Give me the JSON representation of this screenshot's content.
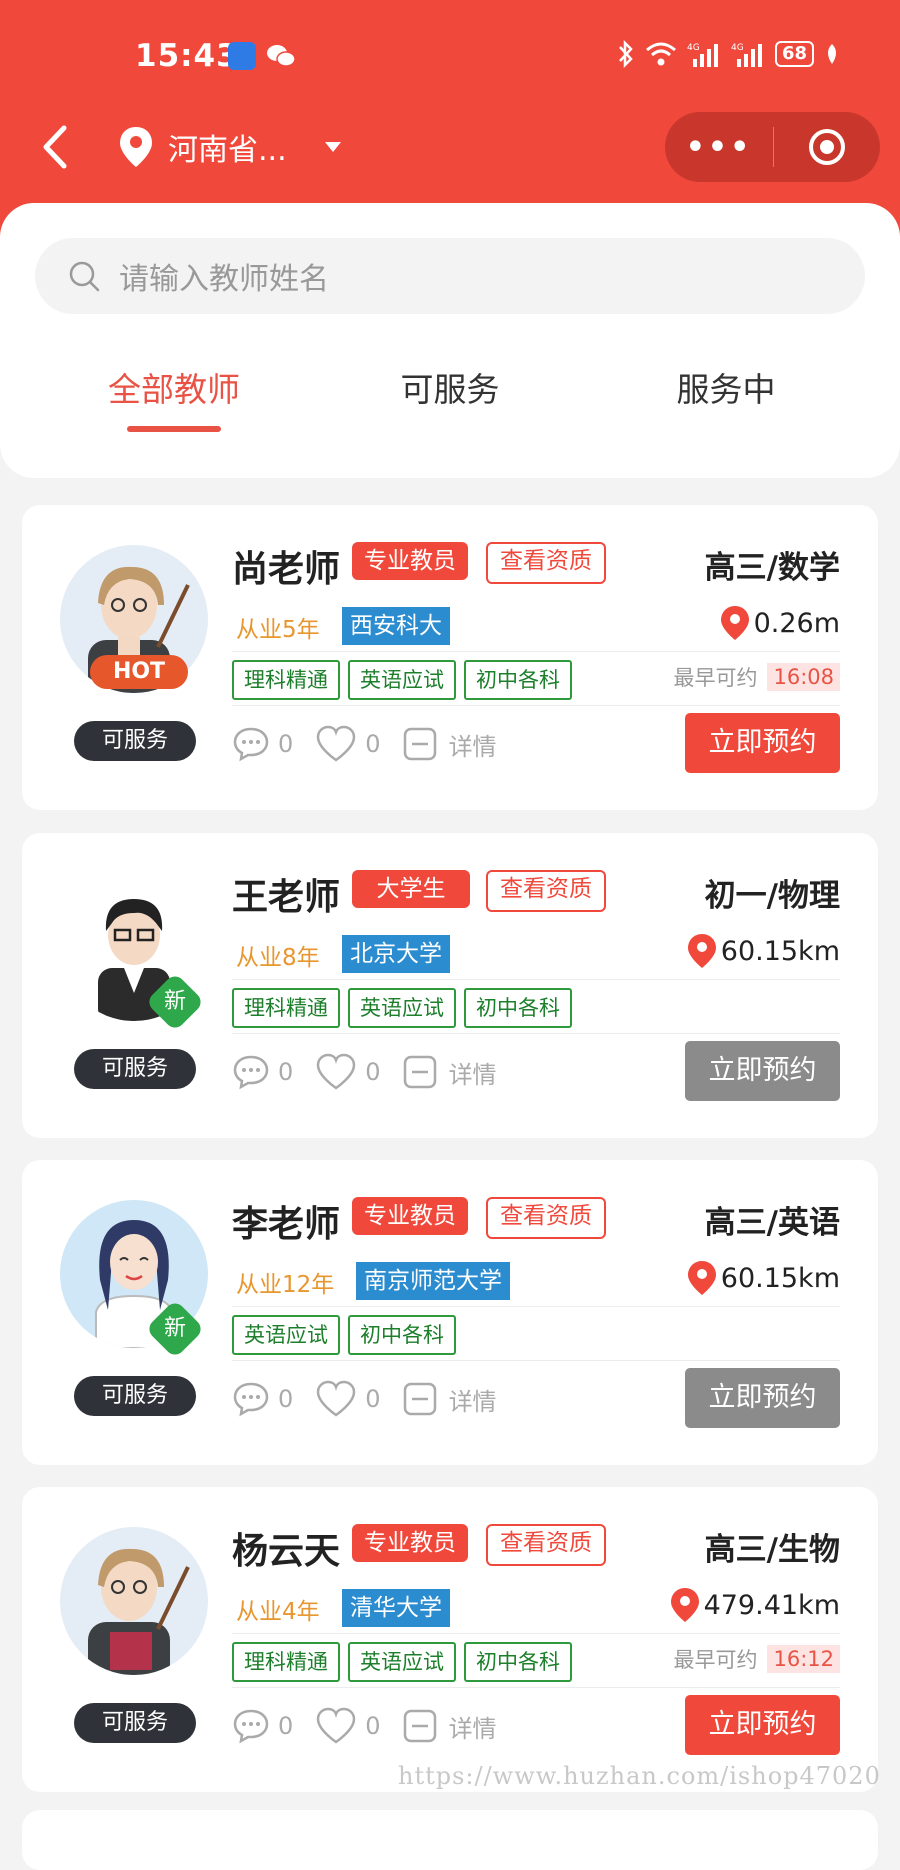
{
  "status_bar": {
    "time": "15:43",
    "battery": "68"
  },
  "nav": {
    "location": "河南省..."
  },
  "search": {
    "placeholder": "请输入教师姓名"
  },
  "tabs": [
    {
      "label": "全部教师",
      "active": true
    },
    {
      "label": "可服务",
      "active": false
    },
    {
      "label": "服务中",
      "active": false
    }
  ],
  "teachers": [
    {
      "name": "尚老师",
      "badge": "专业教员",
      "qual": "查看资质",
      "subject": "高三/数学",
      "years": "从业5年",
      "school": "西安科大",
      "distance": "0.26m",
      "tags": [
        "理科精通",
        "英语应试",
        "初中各科"
      ],
      "earliest_label": "最早可约",
      "earliest_time": "16:08",
      "status": "可服务",
      "comments": "0",
      "likes": "0",
      "detail": "详情",
      "book": "立即预约",
      "book_enabled": true,
      "avatar_badge": "HOT"
    },
    {
      "name": "王老师",
      "badge": "大学生",
      "qual": "查看资质",
      "subject": "初一/物理",
      "years": "从业8年",
      "school": "北京大学",
      "distance": "60.15km",
      "tags": [
        "理科精通",
        "英语应试",
        "初中各科"
      ],
      "status": "可服务",
      "comments": "0",
      "likes": "0",
      "detail": "详情",
      "book": "立即预约",
      "book_enabled": false,
      "avatar_badge": "新"
    },
    {
      "name": "李老师",
      "badge": "专业教员",
      "qual": "查看资质",
      "subject": "高三/英语",
      "years": "从业12年",
      "school": "南京师范大学",
      "distance": "60.15km",
      "tags": [
        "英语应试",
        "初中各科"
      ],
      "status": "可服务",
      "comments": "0",
      "likes": "0",
      "detail": "详情",
      "book": "立即预约",
      "book_enabled": false,
      "avatar_badge": "新"
    },
    {
      "name": "杨云天",
      "badge": "专业教员",
      "qual": "查看资质",
      "subject": "高三/生物",
      "years": "从业4年",
      "school": "清华大学",
      "distance": "479.41km",
      "tags": [
        "理科精通",
        "英语应试",
        "初中各科"
      ],
      "earliest_label": "最早可约",
      "earliest_time": "16:12",
      "status": "可服务",
      "comments": "0",
      "likes": "0",
      "detail": "详情",
      "book": "立即预约",
      "book_enabled": true
    }
  ],
  "watermark": "https://www.huzhan.com/ishop47020",
  "colors": {
    "primary": "#f0493c",
    "school": "#2b8cd0",
    "tag": "#2e9a3c",
    "years": "#e8962f"
  }
}
